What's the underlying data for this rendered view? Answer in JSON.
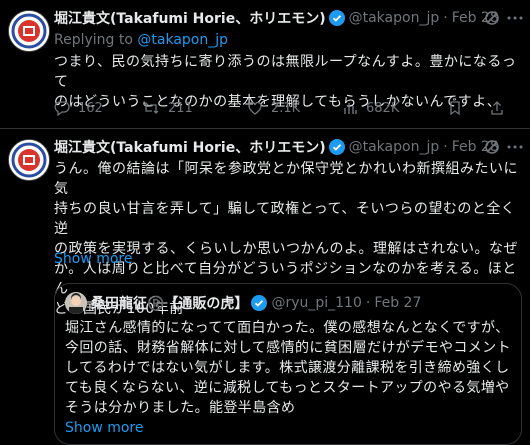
{
  "tweets": [
    {
      "author_name": "堀江貴文(Takafumi Horie、ホリエモン)",
      "handle": "@takapon_jp",
      "dot": "·",
      "time": "Feb 28",
      "replying_label": "Replying to",
      "replying_handle": "@takapon_jp",
      "text": "つまり、民の気持ちに寄り添うのは無限ループなんすよ。豊かになるって\nのはどういうことなのかの基本を理解してもらうしかないんですよ、",
      "replies": "162",
      "reposts": "211",
      "likes": "2.1K",
      "views": "682K"
    },
    {
      "author_name": "堀江貴文(Takafumi Horie、ホリエモン)",
      "handle": "@takapon_jp",
      "dot": "·",
      "time": "Feb 28",
      "text": "うん。俺の結論は「阿呆を参政党とか保守党とかれいわ新撰組みたいに気\n持ちの良い甘言を弄して」騙して政権とって、そいつらの望むのと全く逆\nの政策を実現する、くらいしか思いつかんのよ。理解はされない。なぜ\nか。人は周りと比べて自分がどういうポジションなのかを考える。ほとん\nどの国民が100年前",
      "show_more": "Show more",
      "quote": {
        "author_name": "桑田龍征®️【通販の虎】",
        "handle": "@ryu_pi_110",
        "dot": "·",
        "time": "Feb 27",
        "text": "堀江さん感情的になってて面白かった。僕の感想なんとなくですが、\n今回の話、財務省解体に対して感情的に貧困層だけがデモやコメント\nしてるわけではない気がします。株式譲渡分離課税を引き締め強くし\nても良くならない、逆に減税してもっとスタートアップのやる気増や\nそうは分かりました。能登半島含め",
        "show_more": "Show more"
      }
    }
  ],
  "colors": {
    "text": "#e7e9ea",
    "muted": "#71767b",
    "accent": "#1d9bf0",
    "border": "#2f3336",
    "verified": "#1d9bf0"
  }
}
